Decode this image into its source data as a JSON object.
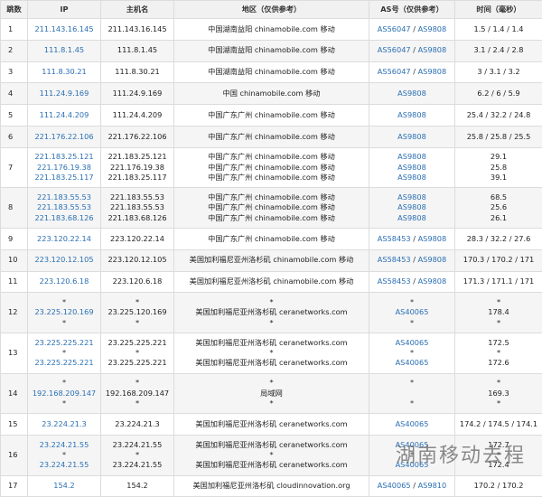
{
  "columns": [
    "跳数",
    "IP",
    "主机名",
    "地区（仅供参考）",
    "AS号（仅供参考）",
    "时间（毫秒）"
  ],
  "rows": [
    {
      "hop": "1",
      "ip": [
        "211.143.16.145"
      ],
      "host": [
        "211.143.16.145"
      ],
      "region": [
        "中国湖南益阳 chinamobile.com 移动"
      ],
      "asn": [
        [
          "AS56047",
          "AS9808"
        ]
      ],
      "time": [
        "1.5 / 1.4 / 1.4"
      ]
    },
    {
      "hop": "2",
      "ip": [
        "111.8.1.45"
      ],
      "host": [
        "111.8.1.45"
      ],
      "region": [
        "中国湖南益阳 chinamobile.com 移动"
      ],
      "asn": [
        [
          "AS56047",
          "AS9808"
        ]
      ],
      "time": [
        "3.1 / 2.4 / 2.8"
      ]
    },
    {
      "hop": "3",
      "ip": [
        "111.8.30.21"
      ],
      "host": [
        "111.8.30.21"
      ],
      "region": [
        "中国湖南益阳 chinamobile.com 移动"
      ],
      "asn": [
        [
          "AS56047",
          "AS9808"
        ]
      ],
      "time": [
        "3 / 3.1 / 3.2"
      ]
    },
    {
      "hop": "4",
      "ip": [
        "111.24.9.169"
      ],
      "host": [
        "111.24.9.169"
      ],
      "region": [
        "中国 chinamobile.com 移动"
      ],
      "asn": [
        [
          "AS9808"
        ]
      ],
      "time": [
        "6.2 / 6 / 5.9"
      ]
    },
    {
      "hop": "5",
      "ip": [
        "111.24.4.209"
      ],
      "host": [
        "111.24.4.209"
      ],
      "region": [
        "中国广东广州 chinamobile.com 移动"
      ],
      "asn": [
        [
          "AS9808"
        ]
      ],
      "time": [
        "25.4 / 32.2 / 24.8"
      ]
    },
    {
      "hop": "6",
      "ip": [
        "221.176.22.106"
      ],
      "host": [
        "221.176.22.106"
      ],
      "region": [
        "中国广东广州 chinamobile.com 移动"
      ],
      "asn": [
        [
          "AS9808"
        ]
      ],
      "time": [
        "25.8 / 25.8 / 25.5"
      ]
    },
    {
      "hop": "7",
      "ip": [
        "221.183.25.121",
        "221.176.19.38",
        "221.183.25.117"
      ],
      "host": [
        "221.183.25.121",
        "221.176.19.38",
        "221.183.25.117"
      ],
      "region": [
        "中国广东广州 chinamobile.com 移动",
        "中国广东广州 chinamobile.com 移动",
        "中国广东广州 chinamobile.com 移动"
      ],
      "asn": [
        [
          "AS9808"
        ],
        [
          "AS9808"
        ],
        [
          "AS9808"
        ]
      ],
      "time": [
        "29.1",
        "25.8",
        "39.1"
      ]
    },
    {
      "hop": "8",
      "ip": [
        "221.183.55.53",
        "221.183.55.53",
        "221.183.68.126"
      ],
      "host": [
        "221.183.55.53",
        "221.183.55.53",
        "221.183.68.126"
      ],
      "region": [
        "中国广东广州 chinamobile.com 移动",
        "中国广东广州 chinamobile.com 移动",
        "中国广东广州 chinamobile.com 移动"
      ],
      "asn": [
        [
          "AS9808"
        ],
        [
          "AS9808"
        ],
        [
          "AS9808"
        ]
      ],
      "time": [
        "68.5",
        "25.6",
        "26.1"
      ]
    },
    {
      "hop": "9",
      "ip": [
        "223.120.22.14"
      ],
      "host": [
        "223.120.22.14"
      ],
      "region": [
        "中国广东广州 chinamobile.com 移动"
      ],
      "asn": [
        [
          "AS58453",
          "AS9808"
        ]
      ],
      "time": [
        "28.3 / 32.2 / 27.6"
      ]
    },
    {
      "hop": "10",
      "ip": [
        "223.120.12.105"
      ],
      "host": [
        "223.120.12.105"
      ],
      "region": [
        "美国加利福尼亚州洛杉矶 chinamobile.com 移动"
      ],
      "asn": [
        [
          "AS58453",
          "AS9808"
        ]
      ],
      "time": [
        "170.3 / 170.2 / 171"
      ]
    },
    {
      "hop": "11",
      "ip": [
        "223.120.6.18"
      ],
      "host": [
        "223.120.6.18"
      ],
      "region": [
        "美国加利福尼亚州洛杉矶 chinamobile.com 移动"
      ],
      "asn": [
        [
          "AS58453",
          "AS9808"
        ]
      ],
      "time": [
        "171.3 / 171.1 / 171"
      ]
    },
    {
      "hop": "12",
      "ip": [
        "*",
        "23.225.120.169",
        "*"
      ],
      "host": [
        "*",
        "23.225.120.169",
        "*"
      ],
      "region": [
        "*",
        "美国加利福尼亚州洛杉矶 ceranetworks.com",
        "*"
      ],
      "asn": [
        [
          "*"
        ],
        [
          "AS40065"
        ],
        [
          "*"
        ]
      ],
      "time": [
        "*",
        "178.4",
        "*"
      ]
    },
    {
      "hop": "13",
      "ip": [
        "23.225.225.221",
        "*",
        "23.225.225.221"
      ],
      "host": [
        "23.225.225.221",
        "*",
        "23.225.225.221"
      ],
      "region": [
        "美国加利福尼亚州洛杉矶 ceranetworks.com",
        "*",
        "美国加利福尼亚州洛杉矶 ceranetworks.com"
      ],
      "asn": [
        [
          "AS40065"
        ],
        [
          "*"
        ],
        [
          "AS40065"
        ]
      ],
      "time": [
        "172.5",
        "*",
        "172.6"
      ]
    },
    {
      "hop": "14",
      "ip": [
        "*",
        "192.168.209.147",
        "*"
      ],
      "host": [
        "*",
        "192.168.209.147",
        "*"
      ],
      "region": [
        "*",
        "局域网",
        "*"
      ],
      "asn": [
        [
          "*"
        ],
        [
          ""
        ],
        [
          "*"
        ]
      ],
      "time": [
        "*",
        "169.3",
        "*"
      ]
    },
    {
      "hop": "15",
      "ip": [
        "23.224.21.3"
      ],
      "host": [
        "23.224.21.3"
      ],
      "region": [
        "美国加利福尼亚州洛杉矶 ceranetworks.com"
      ],
      "asn": [
        [
          "AS40065"
        ]
      ],
      "time": [
        "174.2 / 174.5 / 174.1"
      ]
    },
    {
      "hop": "16",
      "ip": [
        "23.224.21.55",
        "*",
        "23.224.21.55"
      ],
      "host": [
        "23.224.21.55",
        "*",
        "23.224.21.55"
      ],
      "region": [
        "美国加利福尼亚州洛杉矶 ceranetworks.com",
        "*",
        "美国加利福尼亚州洛杉矶 ceranetworks.com"
      ],
      "asn": [
        [
          "AS40065"
        ],
        [
          "*"
        ],
        [
          "AS40065"
        ]
      ],
      "time": [
        "172.7",
        "*",
        "172.4"
      ]
    },
    {
      "hop": "17",
      "ip": [
        "154.2"
      ],
      "host": [
        "154.2"
      ],
      "region": [
        "美国加利福尼亚州洛杉矶 cloudinnovation.org"
      ],
      "asn": [
        [
          "AS40065",
          "AS9810"
        ]
      ],
      "time": [
        "170.2 / 170.2"
      ]
    }
  ],
  "watermark": "湖南移动去程",
  "colors": {
    "link": "#2a6fb3",
    "grid": "#dcdcdc",
    "header_bg": "#f1f1f1",
    "row_alt": "#f5f5f5"
  }
}
